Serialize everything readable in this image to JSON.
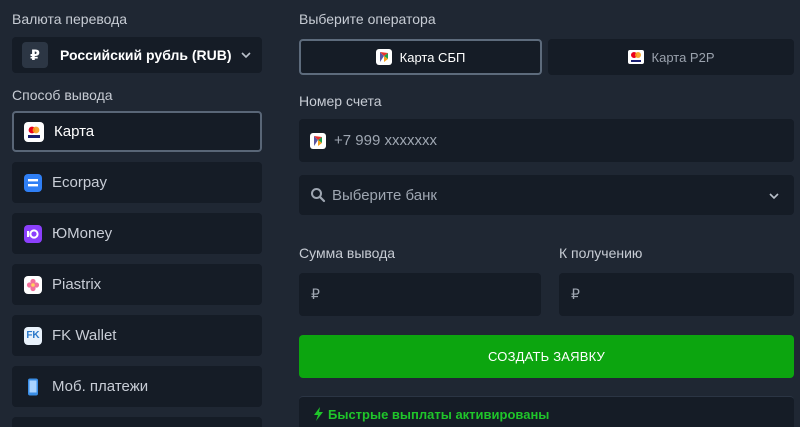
{
  "currency": {
    "title": "Валюта перевода",
    "selected": "Российский рубль (RUB)",
    "symbol": "₽"
  },
  "withdraw": {
    "title": "Способ вывода",
    "methods": [
      {
        "label": "Карта",
        "icon": "card-icon"
      },
      {
        "label": "Ecorpay",
        "icon": "ecorpay-icon"
      },
      {
        "label": "ЮMoney",
        "icon": "yoomoney-icon"
      },
      {
        "label": "Piastrix",
        "icon": "piastrix-icon"
      },
      {
        "label": "FK Wallet",
        "icon": "fk-wallet-icon"
      },
      {
        "label": "Моб. платежи",
        "icon": "phone-icon"
      }
    ]
  },
  "operator": {
    "title": "Выберите оператора",
    "tabs": [
      {
        "label": "Карта СБП",
        "icon": "sbp-icon"
      },
      {
        "label": "Карта P2P",
        "icon": "card-icon"
      }
    ]
  },
  "account": {
    "title": "Номер счета",
    "placeholder": "+7 999 xxxxxxx"
  },
  "bank": {
    "placeholder": "Выберите банк"
  },
  "amount": {
    "withdraw_label": "Сумма вывода",
    "receive_label": "К получению",
    "currency_symbol": "₽"
  },
  "submit_label": "СОЗДАТЬ ЗАЯВКУ",
  "banner": "Быстрые выплаты активированы",
  "colors": {
    "background": "#1f2733",
    "field": "#151c26",
    "accent_green": "#0ca50f",
    "banner_green": "#1fc52a"
  }
}
